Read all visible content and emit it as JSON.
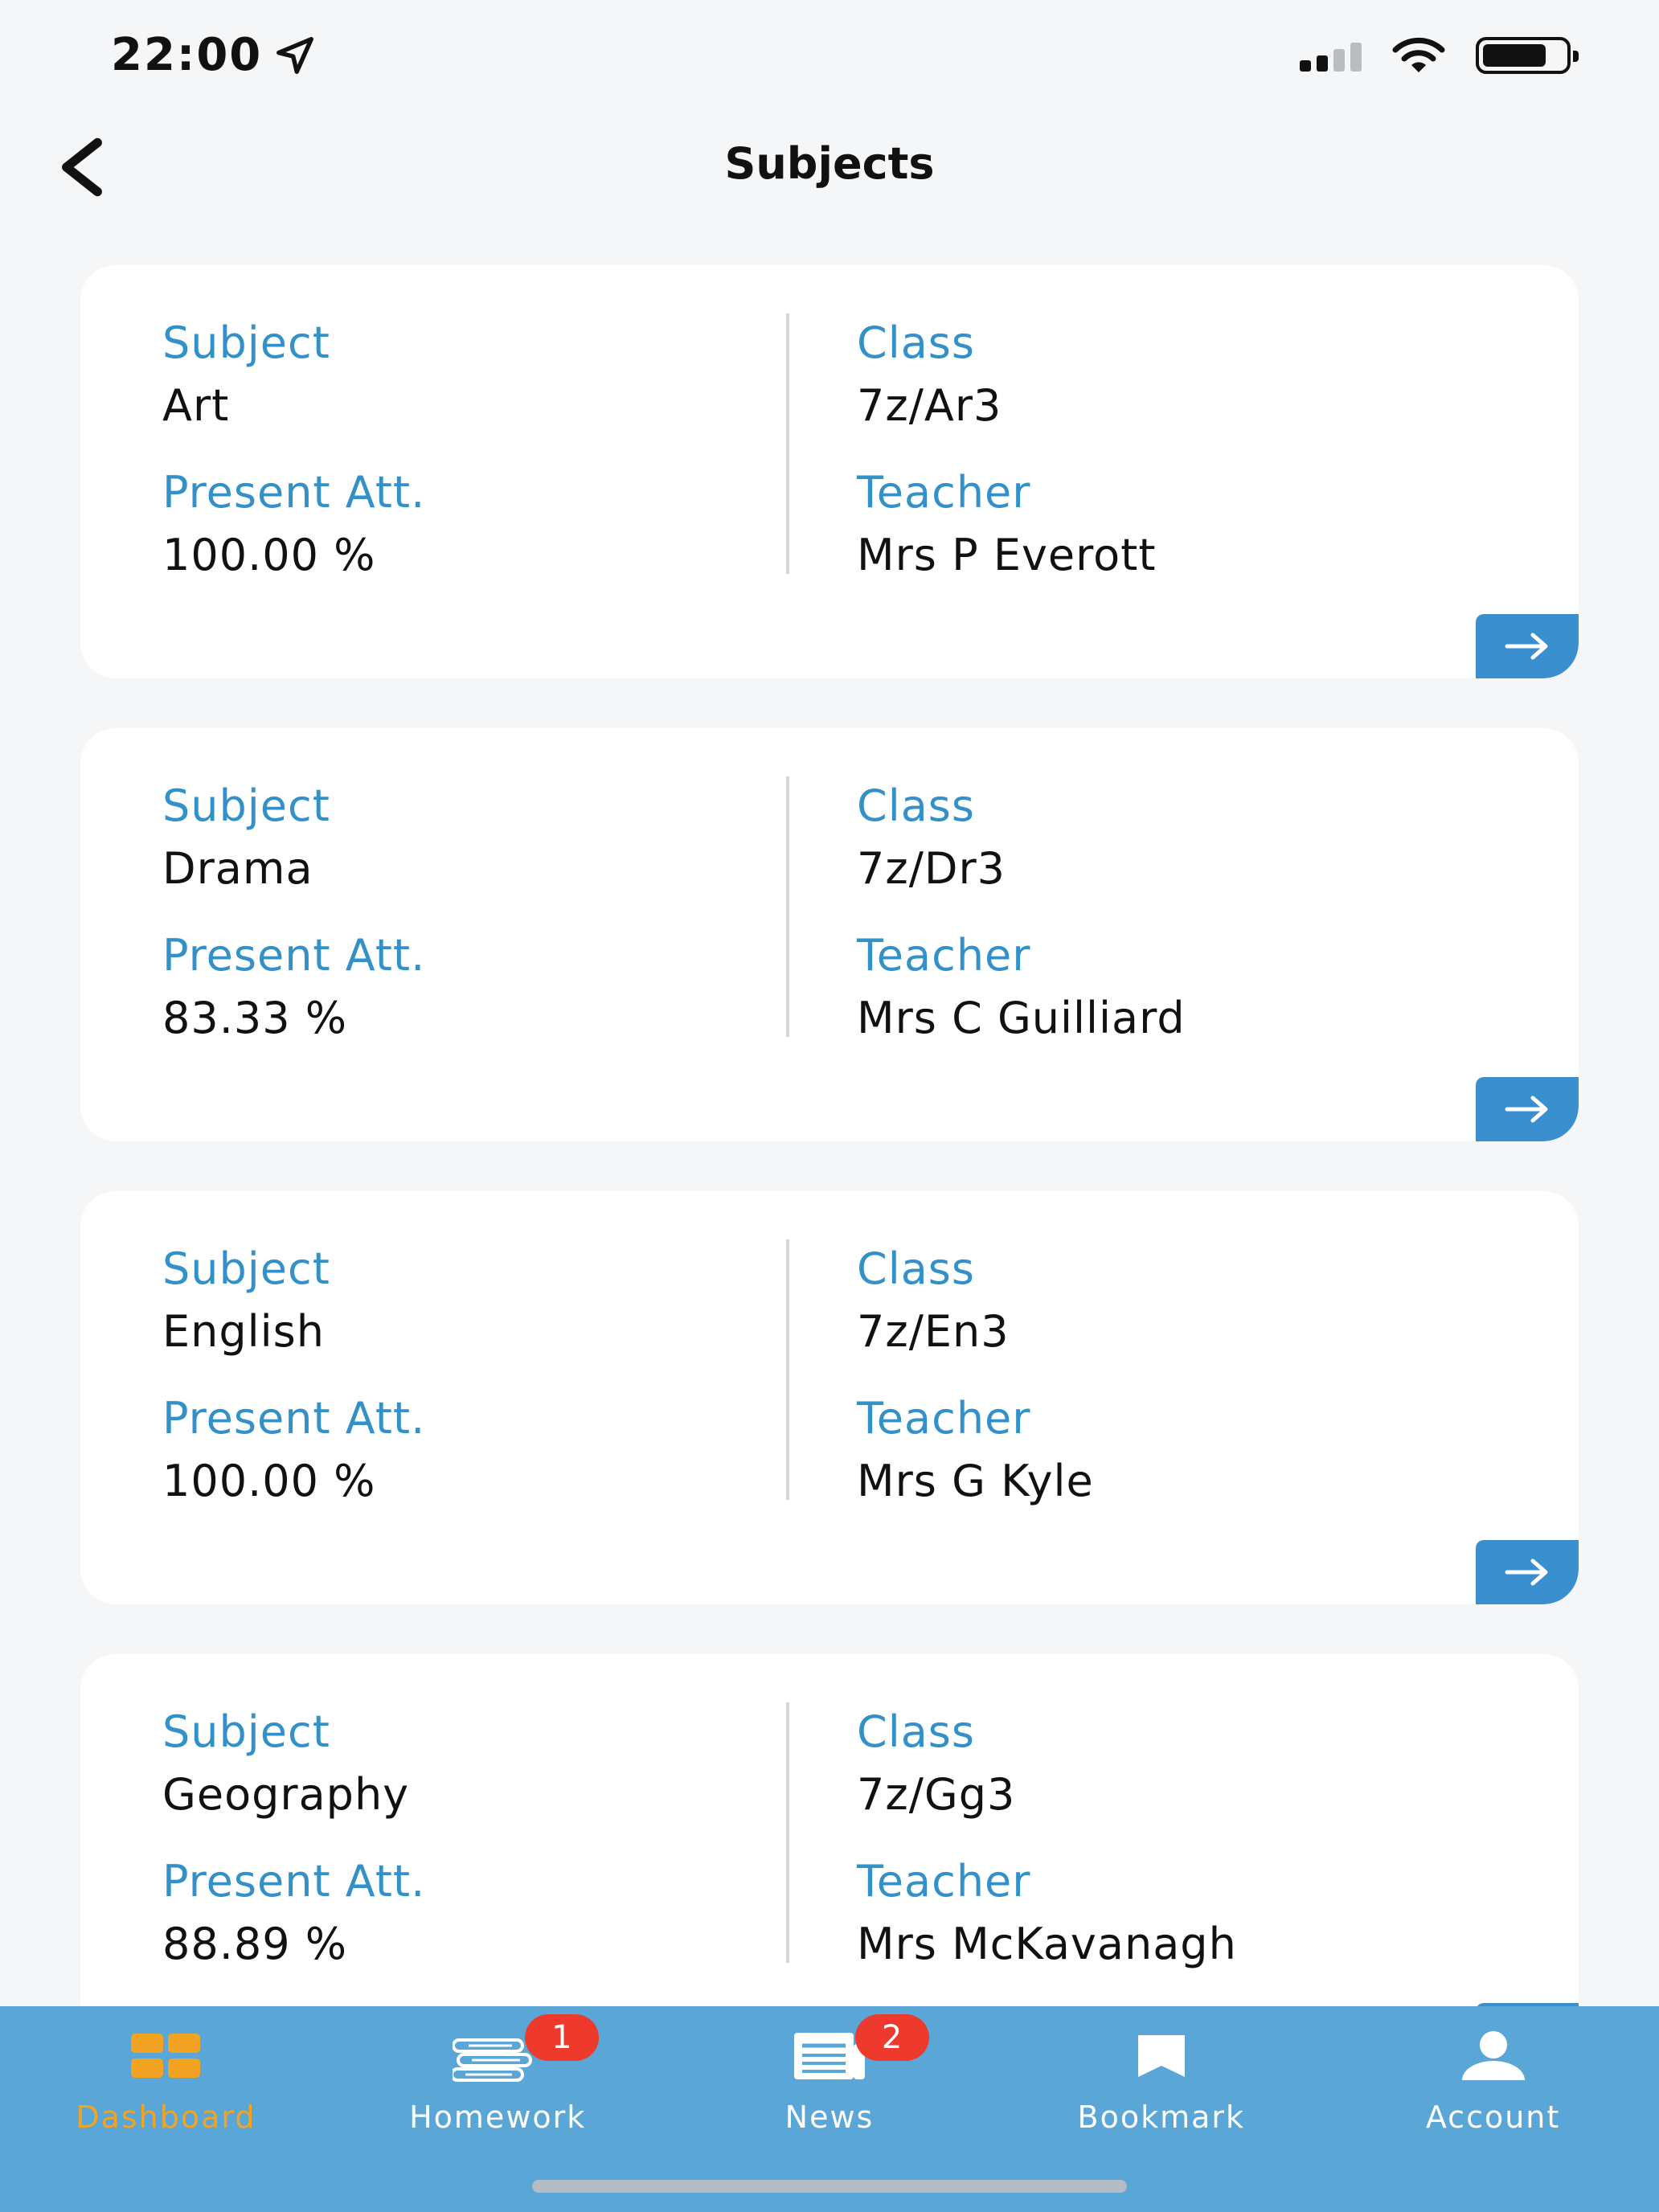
{
  "status_bar": {
    "time": "22:00",
    "icons": [
      "location-arrow-icon",
      "cellular-signal-icon",
      "wifi-icon",
      "battery-icon"
    ]
  },
  "header": {
    "title": "Subjects",
    "back_icon": "chevron-left-icon"
  },
  "cards": [
    {
      "subject_label": "Subject",
      "subject": "Art",
      "att_label": "Present Att.",
      "attendance": "100.00 %",
      "class_label": "Class",
      "class": "7z/Ar3",
      "teacher_label": "Teacher",
      "teacher": "Mrs P Everott"
    },
    {
      "subject_label": "Subject",
      "subject": "Drama",
      "att_label": "Present Att.",
      "attendance": "83.33 %",
      "class_label": "Class",
      "class": "7z/Dr3",
      "teacher_label": "Teacher",
      "teacher": "Mrs C Guilliard"
    },
    {
      "subject_label": "Subject",
      "subject": "English",
      "att_label": "Present Att.",
      "attendance": "100.00 %",
      "class_label": "Class",
      "class": "7z/En3",
      "teacher_label": "Teacher",
      "teacher": "Mrs G Kyle"
    },
    {
      "subject_label": "Subject",
      "subject": "Geography",
      "att_label": "Present Att.",
      "attendance": "88.89 %",
      "class_label": "Class",
      "class": "7z/Gg3",
      "teacher_label": "Teacher",
      "teacher": "Mrs McKavanagh"
    }
  ],
  "tab_bar": {
    "items": [
      {
        "label": "Dashboard",
        "icon": "dashboard-grid-icon",
        "active": true,
        "badge": ""
      },
      {
        "label": "Homework",
        "icon": "books-icon",
        "active": false,
        "badge": "1"
      },
      {
        "label": "News",
        "icon": "newspaper-icon",
        "active": false,
        "badge": "2"
      },
      {
        "label": "Bookmark",
        "icon": "bookmark-icon",
        "active": false,
        "badge": ""
      },
      {
        "label": "Account",
        "icon": "person-icon",
        "active": false,
        "badge": ""
      }
    ]
  },
  "colors": {
    "accent_blue": "#3390c8",
    "button_blue": "#3a8fcf",
    "tab_bar_bg": "#5aa6d7",
    "active_tab": "#f2a322",
    "badge_red": "#ee3a2c",
    "page_bg": "#f5f6f8"
  }
}
